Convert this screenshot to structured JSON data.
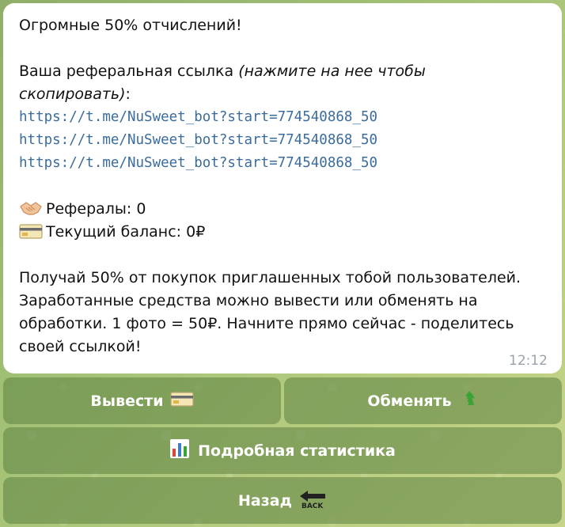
{
  "message": {
    "title": "Огромные 50% отчислений!",
    "ref_label": "Ваша реферальная ссылка ",
    "ref_note_1": "(нажмите на нее чтобы",
    "ref_note_2": "скопировать)",
    "ref_colon": ":",
    "links": [
      "https://t.me/NuSweet_bot?start=774540868_50",
      "https://t.me/NuSweet_bot?start=774540868_50",
      "https://t.me/NuSweet_bot?start=774540868_50"
    ],
    "referrals": "Рефералы: 0",
    "balance": "Текущий баланс: 0₽",
    "description": [
      "Получай 50% от покупок приглашенных тобой пользователей.",
      "Заработанные средства можно вывести или обменять на",
      "обработки. 1 фото = 50₽. Начните прямо сейчас - поделитесь",
      "своей ссылкой!"
    ],
    "time": "12:12",
    "icons": {
      "referrals": "handshake-icon",
      "balance": "credit-card-icon"
    }
  },
  "keyboard": {
    "withdraw": "Вывести",
    "exchange": "Обменять",
    "stats": "Подробная статистика",
    "back": "Назад",
    "back_icon_text": "BACK",
    "icons": {
      "withdraw": "credit-card-icon",
      "exchange": "recycle-icon",
      "stats": "bar-chart-icon",
      "back": "back-arrow-icon"
    }
  },
  "colors": {
    "bubble": "#ffffff",
    "link": "#3a6c9c",
    "time": "#9aa3ab",
    "button": "#5c8242"
  }
}
